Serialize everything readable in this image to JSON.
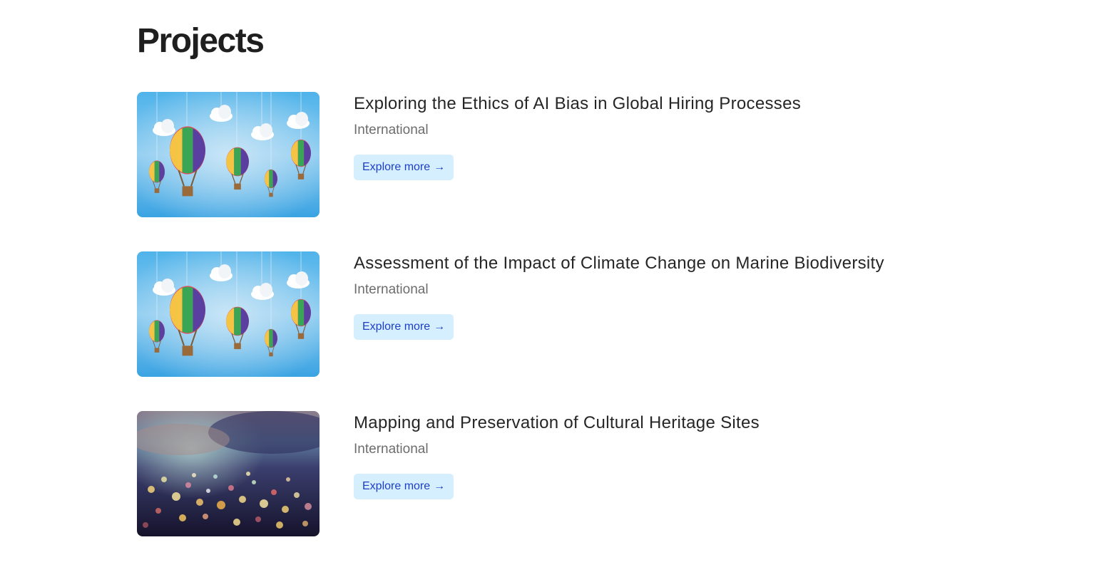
{
  "page": {
    "title": "Projects"
  },
  "projects": [
    {
      "title": "Exploring the Ethics of AI Bias in Global Hiring Processes",
      "tag": "International",
      "button_label": "Explore more",
      "button_icon": "arrow-right-icon",
      "image": "hot-air-balloons-image"
    },
    {
      "title": "Assessment of the Impact of Climate Change on Marine Biodiversity",
      "tag": "International",
      "button_label": "Explore more",
      "button_icon": "arrow-right-icon",
      "image": "hot-air-balloons-image"
    },
    {
      "title": "Mapping and Preservation of Cultural Heritage Sites",
      "tag": "International",
      "button_label": "Explore more",
      "button_icon": "arrow-right-icon",
      "image": "city-bokeh-image"
    }
  ],
  "colors": {
    "button_bg": "#d6efff",
    "button_text": "#1c3fc6",
    "tag_text": "#6d6d6d",
    "title_text": "#262626"
  }
}
